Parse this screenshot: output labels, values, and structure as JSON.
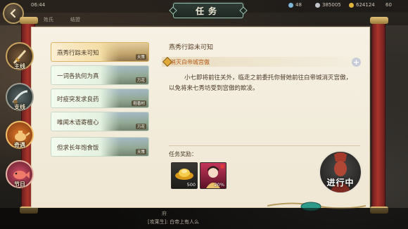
{
  "title": "任务",
  "status_bar": {
    "time": "06:44",
    "stat_1": "48",
    "stat_2": "385005",
    "stat_3": "624124",
    "stat_4": "60"
  },
  "sub_bar": {
    "text_1": "姓氏",
    "text_2": "结盟"
  },
  "nav": [
    {
      "label": "主线",
      "icon": "sword-icon"
    },
    {
      "label": "支线",
      "icon": "blade-icon"
    },
    {
      "label": "奇遇",
      "icon": "teapot-icon"
    },
    {
      "label": "节日",
      "icon": "koi-fish-icon"
    }
  ],
  "quests": [
    {
      "name": "燕秀行踪未可知",
      "place": "天策",
      "active": true
    },
    {
      "name": "一词各执何为真",
      "place": "万花",
      "active": false
    },
    {
      "name": "时疫突发求良药",
      "place": "稻香村",
      "active": false
    },
    {
      "name": "唯闻木语寄檀心",
      "place": "万花",
      "active": false
    },
    {
      "name": "但求长年饱食饭",
      "place": "天策",
      "active": false
    }
  ],
  "detail": {
    "title": "燕秀行踪未可知",
    "goal": "消灭白帝城宫傲",
    "description": "小七即将前往关外，临走之前委托你替她前往白帝城消灭宫傲，以免将来七秀坊受到宫傲的欺凌。",
    "reward_label": "任务奖励：",
    "rewards": [
      {
        "icon": "gold-ingot-icon",
        "count": "500"
      },
      {
        "icon": "character-portrait-icon",
        "count": "20%"
      }
    ]
  },
  "progress_badge": "进行中",
  "chat": {
    "name": "府",
    "message": "[攻莱生]: 白帝上有人么"
  },
  "colors": {
    "accent_gold": "#d9b463",
    "goal_orange": "#b35a14",
    "rod_red": "#a9342b",
    "banner_green": "#9ec7b2"
  }
}
